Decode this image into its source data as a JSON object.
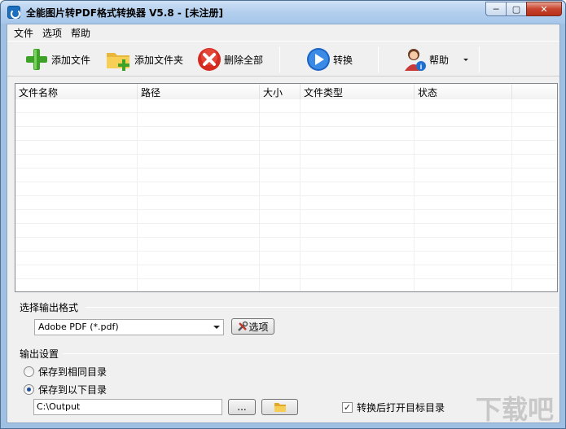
{
  "window": {
    "title": "全能图片转PDF格式转换器 V5.8 - [未注册]",
    "min_symbol": "─",
    "max_symbol": "▢",
    "close_symbol": "✕"
  },
  "menu": [
    "文件",
    "选项",
    "帮助"
  ],
  "toolbar": {
    "add_file": "添加文件",
    "add_folder": "添加文件夹",
    "delete_all": "删除全部",
    "convert": "转换",
    "help": "帮助"
  },
  "list": {
    "columns": [
      "文件名称",
      "路径",
      "大小",
      "文件类型",
      "状态"
    ],
    "rows": []
  },
  "output_format": {
    "group_label": "选择输出格式",
    "selected": "Adobe PDF (*.pdf)",
    "options_button": "选项"
  },
  "output_settings": {
    "group_label": "输出设置",
    "radio_same_dir": "保存到相同目录",
    "radio_custom_dir": "保存到以下目录",
    "selected": "custom",
    "path": "C:\\Output",
    "browse_button": "...",
    "open_after_label": "转换后打开目标目录",
    "open_after_checked": true
  },
  "watermark": "下载吧"
}
